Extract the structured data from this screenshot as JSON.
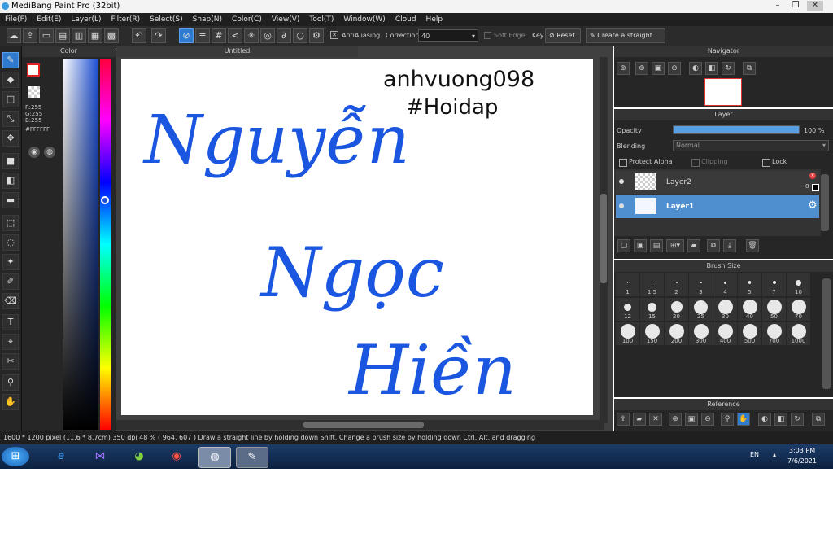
{
  "window": {
    "title": "MediBang Paint Pro (32bit)",
    "minimize": "–",
    "maximize": "❐",
    "close": "✕"
  },
  "menu": [
    "File(F)",
    "Edit(E)",
    "Layer(L)",
    "Filter(R)",
    "Select(S)",
    "Snap(N)",
    "Color(C)",
    "View(V)",
    "Tool(T)",
    "Window(W)",
    "Cloud",
    "Help"
  ],
  "toolbar": {
    "antialiasing_label": "AntiAliasing",
    "correction_label": "Correction",
    "correction_value": "40",
    "soft_edge_label": "Soft Edge",
    "key_label": "Key",
    "reset_label": "Reset",
    "straight_line_label": "Create a straight line"
  },
  "color_panel": {
    "title": "Color",
    "r": "R:255",
    "g": "G:255",
    "b": "B:255",
    "hex": "#FFFFFF"
  },
  "canvas": {
    "tab": "Untitled",
    "text_main": [
      "Nguyễn",
      "Ngọc",
      "Hiền"
    ],
    "text_signature": "anhvuong098",
    "text_hashtag": "#Hoidap"
  },
  "navigator": {
    "title": "Navigator"
  },
  "layer_panel": {
    "title": "Layer",
    "opacity_label": "Opacity",
    "opacity_value": "100 %",
    "opacity_fraction": 1.0,
    "blending_label": "Blending",
    "blending_value": "Normal",
    "protect_alpha": "Protect Alpha",
    "clipping": "Clipping",
    "lock": "Lock",
    "layers": [
      {
        "name": "Layer2",
        "selected": false,
        "badge": "8"
      },
      {
        "name": "Layer1",
        "selected": true,
        "badge": ""
      }
    ]
  },
  "brush_size": {
    "title": "Brush Size",
    "sizes": [
      "1",
      "1.5",
      "2",
      "3",
      "4",
      "5",
      "7",
      "10",
      "12",
      "15",
      "20",
      "25",
      "30",
      "40",
      "50",
      "70",
      "100",
      "150",
      "200",
      "300",
      "400",
      "500",
      "700",
      "1000"
    ]
  },
  "reference": {
    "title": "Reference"
  },
  "status": {
    "text": "1600 * 1200 pixel   (11.6 * 8.7cm)  350 dpi   48 %   ( 964, 607 )   Draw a straight line by holding down Shift, Change a brush size by holding down Ctrl, Alt, and dragging"
  },
  "taskbar": {
    "lang": "EN",
    "time": "3:03 PM",
    "date": "7/6/2021"
  },
  "colors": {
    "accent": "#2f7bd0",
    "ink": "#1a56e0",
    "panel": "#262626"
  }
}
